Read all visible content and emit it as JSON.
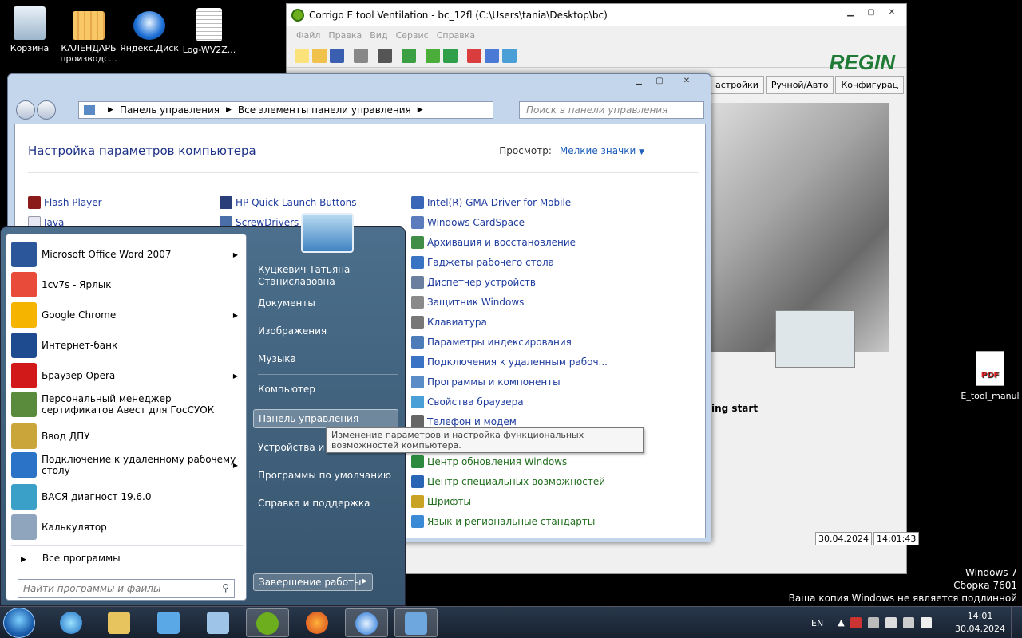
{
  "colors": {
    "desktop": "#000000",
    "link_blue": "#1e3c9e",
    "heading": "#1e3287",
    "regin_green": "#1e7a34"
  },
  "desktop": {
    "icons": [
      {
        "label": "Корзина",
        "icon": "recycle-bin-icon"
      },
      {
        "label": "КАЛЕНДАРЬ производс...",
        "icon": "spreadsheet-icon"
      },
      {
        "label": "Яндекс.Диск",
        "icon": "yandex-disk-icon"
      },
      {
        "label": "Log-WV2Z...",
        "icon": "text-file-icon"
      }
    ],
    "pdf_icon_label": "E_tool_manul",
    "win_info": [
      "Windows 7",
      "Сборка 7601",
      "Ваша копия Windows не является подлинной"
    ]
  },
  "corrigo": {
    "title": "Corrigo E tool Ventilation - bc_12fl (C:\\Users\\tania\\Desktop\\bc)",
    "menu": [
      "Файл",
      "Правка",
      "Вид",
      "Сервис",
      "Справка"
    ],
    "brand": "REGIN",
    "tabs": [
      "астройки",
      "Ручной/Авто",
      "Конфигурац"
    ],
    "start_text": "ing start",
    "status_date": "30.04.2024",
    "status_time": "14:01:43"
  },
  "cpanel": {
    "breadcrumb": [
      "Панель управления",
      "Все элементы панели управления"
    ],
    "search_placeholder": "Поиск в панели управления",
    "heading": "Настройка параметров компьютера",
    "view_label": "Просмотр:",
    "view_value": "Мелкие значки",
    "col1": [
      "Flash Player",
      "Java"
    ],
    "col2": [
      "HP Quick Launch Buttons",
      "ScrewDrivers Cli"
    ],
    "col3": [
      "Intel(R) GMA Driver for Mobile",
      "Windows CardSpace",
      "Архивация и восстановление",
      "Гаджеты рабочего стола",
      "Диспетчер устройств",
      "Защитник Windows",
      "Клавиатура",
      "Параметры индексирования",
      "Подключения к удаленным рабоч...",
      "Программы и компоненты",
      "Свойства браузера",
      "Телефон и модем"
    ],
    "col3_bottom": [
      "Центр обновления Windows",
      "Центр специальных возможностей",
      "Шрифты",
      "Язык и региональные стандарты"
    ]
  },
  "startmenu": {
    "programs": [
      {
        "label": "Microsoft Office Word 2007",
        "arrow": true
      },
      {
        "label": "1cv7s - Ярлык",
        "arrow": false
      },
      {
        "label": "Google Chrome",
        "arrow": true
      },
      {
        "label": "Интернет-банк",
        "arrow": false
      },
      {
        "label": "Браузер Opera",
        "arrow": true
      },
      {
        "label": "Персональный менеджер сертификатов Авест для ГосСУОК",
        "arrow": false
      },
      {
        "label": "Ввод ДПУ",
        "arrow": false
      },
      {
        "label": "Подключение к удаленному рабочему столу",
        "arrow": true
      },
      {
        "label": "ВАСЯ диагност 19.6.0",
        "arrow": false
      },
      {
        "label": "Калькулятор",
        "arrow": false
      }
    ],
    "all_programs": "Все программы",
    "search_placeholder": "Найти программы и файлы",
    "user": "Куцкевич Татьяна Станиславовна",
    "right": [
      "Документы",
      "Изображения",
      "Музыка",
      "Компьютер",
      "Панель управления",
      "Устройства и п",
      "Программы по умолчанию",
      "Справка и поддержка"
    ],
    "shutdown": "Завершение работы"
  },
  "tooltip": "Изменение параметров и настройка функциональных возможностей компьютера.",
  "taskbar": {
    "lang": "EN",
    "time": "14:01",
    "date": "30.04.2024"
  }
}
